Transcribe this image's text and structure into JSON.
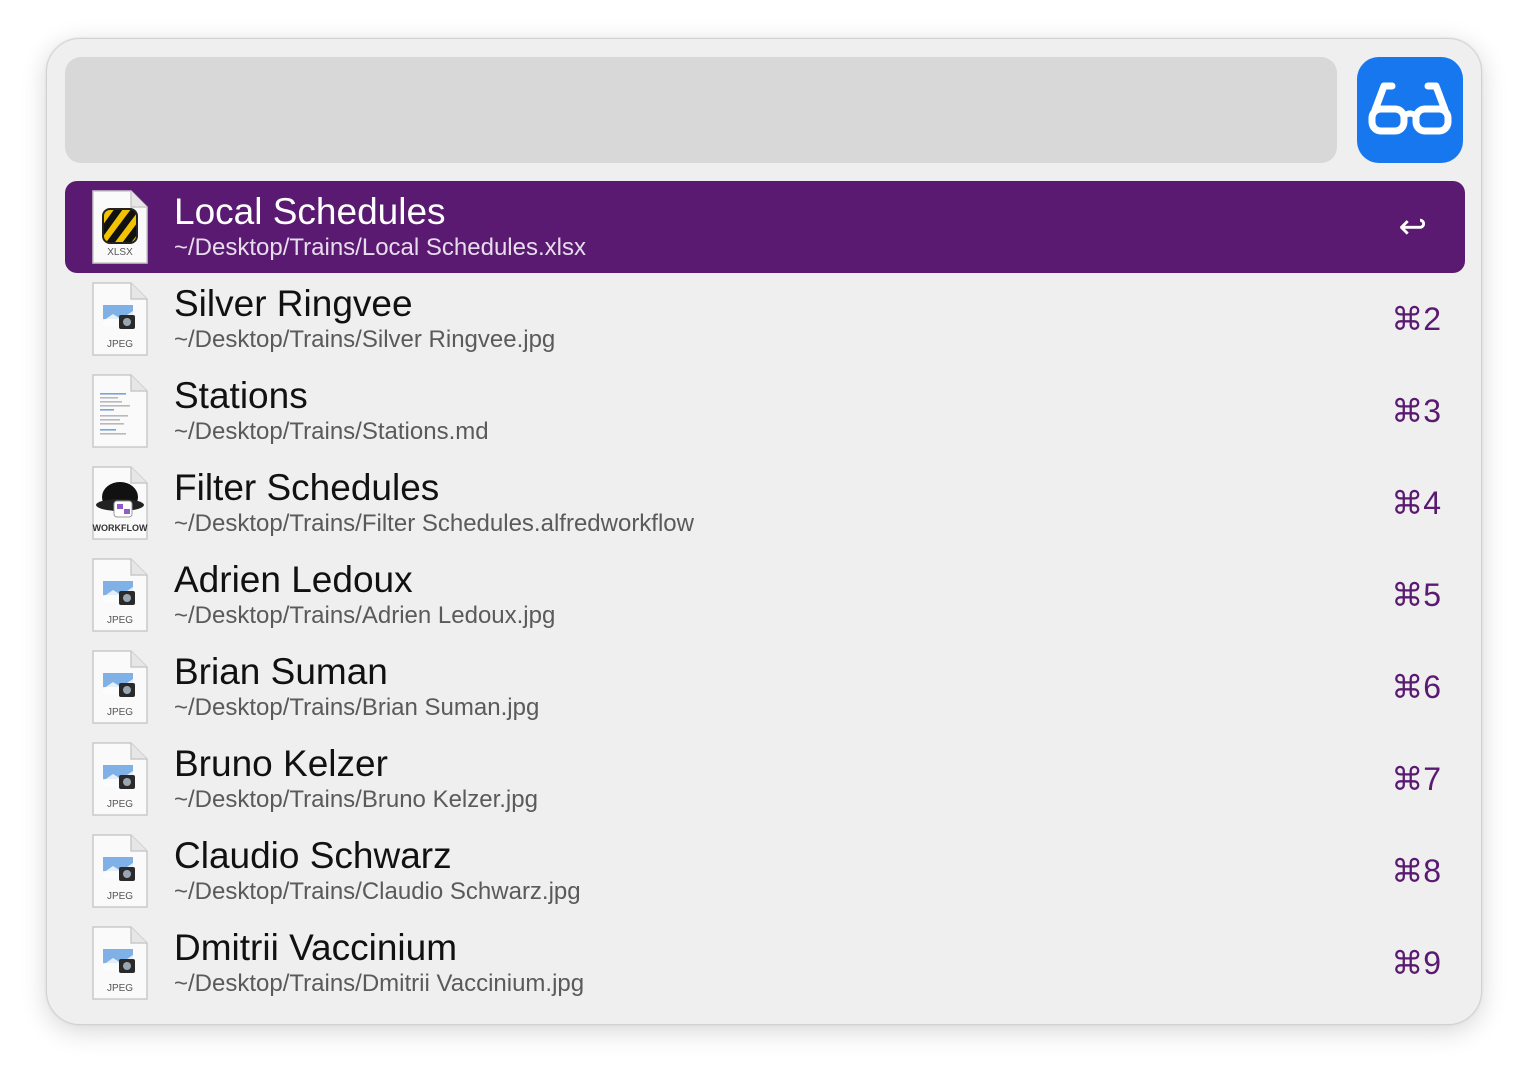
{
  "search": {
    "value": "",
    "placeholder": ""
  },
  "app_icon": "alfred-glasses-icon",
  "colors": {
    "selection": "#5b1a72",
    "accent": "#1677ee",
    "shortcut": "#5b1a72"
  },
  "results": [
    {
      "title": "Local Schedules",
      "subtitle": "~/Desktop/Trains/Local Schedules.xlsx",
      "shortcut": "↩",
      "icon_label": "XLSX",
      "icon": "xlsx-file-icon",
      "selected": true
    },
    {
      "title": "Silver Ringvee",
      "subtitle": "~/Desktop/Trains/Silver Ringvee.jpg",
      "shortcut": "⌘2",
      "icon_label": "JPEG",
      "icon": "jpeg-file-icon"
    },
    {
      "title": "Stations",
      "subtitle": "~/Desktop/Trains/Stations.md",
      "shortcut": "⌘3",
      "icon_label": "",
      "icon": "markdown-file-icon"
    },
    {
      "title": "Filter Schedules",
      "subtitle": "~/Desktop/Trains/Filter Schedules.alfredworkflow",
      "shortcut": "⌘4",
      "icon_label": "WORKFLOW",
      "icon": "workflow-file-icon"
    },
    {
      "title": "Adrien Ledoux",
      "subtitle": "~/Desktop/Trains/Adrien Ledoux.jpg",
      "shortcut": "⌘5",
      "icon_label": "JPEG",
      "icon": "jpeg-file-icon"
    },
    {
      "title": "Brian Suman",
      "subtitle": "~/Desktop/Trains/Brian Suman.jpg",
      "shortcut": "⌘6",
      "icon_label": "JPEG",
      "icon": "jpeg-file-icon"
    },
    {
      "title": "Bruno Kelzer",
      "subtitle": "~/Desktop/Trains/Bruno Kelzer.jpg",
      "shortcut": "⌘7",
      "icon_label": "JPEG",
      "icon": "jpeg-file-icon"
    },
    {
      "title": "Claudio Schwarz",
      "subtitle": "~/Desktop/Trains/Claudio Schwarz.jpg",
      "shortcut": "⌘8",
      "icon_label": "JPEG",
      "icon": "jpeg-file-icon"
    },
    {
      "title": "Dmitrii Vaccinium",
      "subtitle": "~/Desktop/Trains/Dmitrii Vaccinium.jpg",
      "shortcut": "⌘9",
      "icon_label": "JPEG",
      "icon": "jpeg-file-icon"
    }
  ]
}
